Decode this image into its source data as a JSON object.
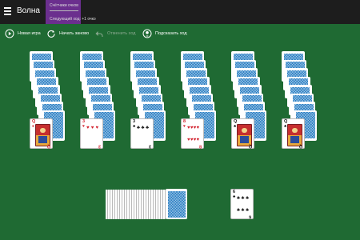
{
  "app": {
    "title": "Волна"
  },
  "score": {
    "label": "Счётчики очков",
    "next_move": "Следующий ход: +1 очко"
  },
  "toolbar": [
    {
      "label": "Новая игра",
      "icon": "play-icon",
      "enabled": true
    },
    {
      "label": "Начать заново",
      "icon": "restart-icon",
      "enabled": true
    },
    {
      "label": "Отменить ход",
      "icon": "undo-icon",
      "enabled": false
    },
    {
      "label": "Подсказать ход",
      "icon": "hint-icon",
      "enabled": true
    }
  ],
  "tableau": [
    {
      "face_down": 8,
      "top": {
        "rank": "Q",
        "suit": "♦",
        "color": "red"
      }
    },
    {
      "face_down": 8,
      "top": {
        "rank": "3",
        "suit": "♥",
        "color": "red"
      }
    },
    {
      "face_down": 8,
      "top": {
        "rank": "3",
        "suit": "♣",
        "color": "black"
      }
    },
    {
      "face_down": 8,
      "top": {
        "rank": "8",
        "suit": "♥",
        "color": "red"
      }
    },
    {
      "face_down": 8,
      "top": {
        "rank": "Q",
        "suit": "♣",
        "color": "black"
      }
    },
    {
      "face_down": 8,
      "top": {
        "rank": "Q",
        "suit": "♣",
        "color": "black"
      }
    }
  ],
  "stock": {
    "cards": 26
  },
  "waste": {
    "rank": "6",
    "suit": "♣",
    "color": "black"
  },
  "colors": {
    "felt": "#1f6a33",
    "topbar": "#1d1d1d",
    "score_accent": "#6b2f8e",
    "card_back": "#2a7fc4"
  }
}
